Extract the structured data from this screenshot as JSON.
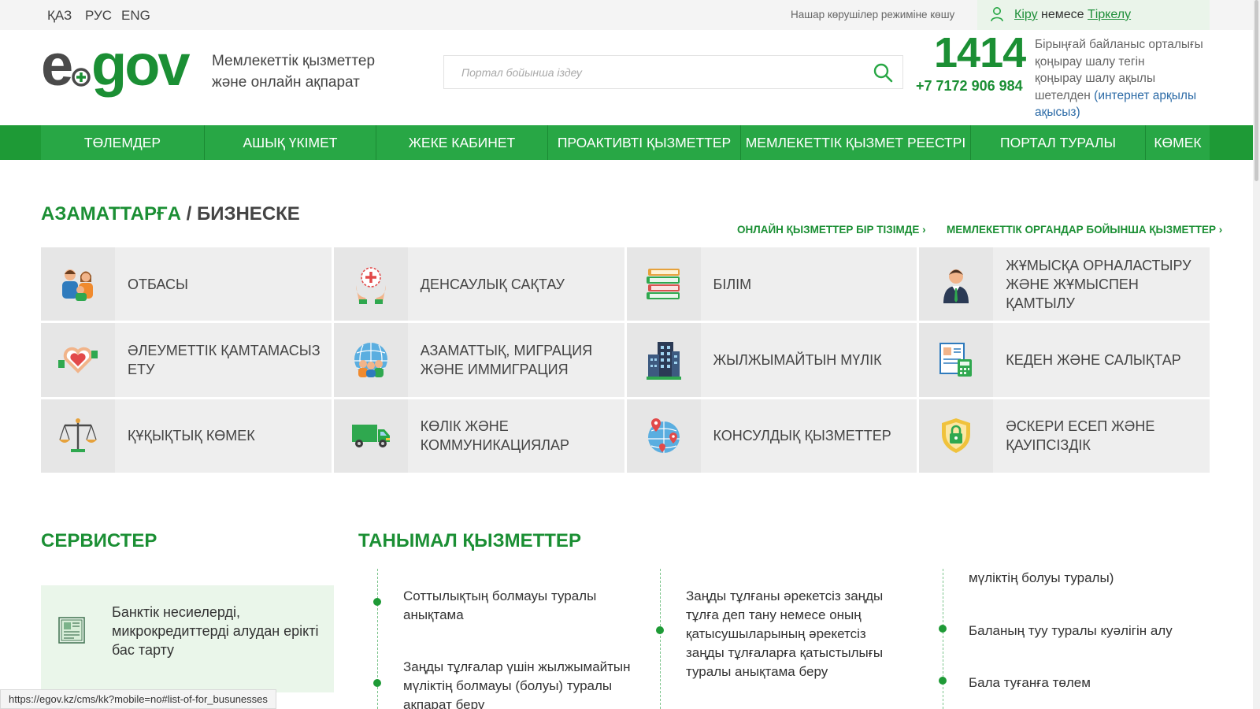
{
  "topbar": {
    "languages": [
      "ҚАЗ",
      "РУС",
      "ENG"
    ],
    "visually_impaired": "Нашар көрушілер режиміне көшу",
    "login_text": "Кіру",
    "login_sep": " немесе ",
    "register_text": "Тіркелу"
  },
  "header": {
    "logo_text": "egov",
    "tagline_1": "Мемлекеттік қызметтер",
    "tagline_2": "және онлайн ақпарат",
    "search_placeholder": "Портал бойынша іздеу",
    "hotline_number": "1414",
    "phone": "+7 7172 906 984",
    "contact_1": "Бірыңғай байланыс орталығы",
    "contact_2": "қоңырау шалу тегін",
    "contact_3": "қоңырау шалу ақылы",
    "contact_4": "шетелден ",
    "contact_5": "(интернет арқылы ақысыз)"
  },
  "nav": [
    "ТӨЛЕМДЕР",
    "АШЫҚ ҮКІМЕТ",
    "ЖЕКЕ КАБИНЕТ",
    "ПРОАКТИВТІ ҚЫЗМЕТТЕР",
    "МЕМЛЕКЕТТІК ҚЫЗМЕТ РЕЕСТРІ",
    "ПОРТАЛ ТУРАЛЫ",
    "КӨМЕК"
  ],
  "citizens": {
    "title": "АЗАМАТТАРҒА",
    "title_sep": " / ",
    "title_2": "БИЗНЕСКЕ",
    "link_1": "ОНЛАЙН ҚЫЗМЕТТЕР БІР ТІЗІМДЕ ›",
    "link_2": "МЕМЛЕКЕТТІК ОРГАНДАР БОЙЫНША ҚЫЗМЕТТЕР ›",
    "tiles": [
      {
        "label": "Отбасы",
        "icon": "family-icon"
      },
      {
        "label": "Денсаулық сақтау",
        "icon": "health-icon"
      },
      {
        "label": "Білім",
        "icon": "books-icon"
      },
      {
        "label": "Жұмысқа орналастыру және жұмыспен қамтылу",
        "icon": "employee-icon"
      },
      {
        "label": "Әлеуметтік қамтамасыз ету",
        "icon": "heart-hands-icon"
      },
      {
        "label": "Азаматтық, миграция және иммиграция",
        "icon": "globe-people-icon"
      },
      {
        "label": "Жылжымайтын мүлік",
        "icon": "building-icon"
      },
      {
        "label": "Кеден және салықтар",
        "icon": "tax-calculator-icon"
      },
      {
        "label": "Құқықтық көмек",
        "icon": "scales-icon"
      },
      {
        "label": "Көлік және коммуникациялар",
        "icon": "truck-icon"
      },
      {
        "label": "Консулдық қызметтер",
        "icon": "globe-pin-icon"
      },
      {
        "label": "Әскери есеп және қауіпсіздік",
        "icon": "shield-lock-icon"
      }
    ]
  },
  "services": {
    "title": "СЕРВИСТЕР",
    "card_label": "Банктік несиелерді, микрокредиттерді алудан ерікті бас тарту"
  },
  "popular": {
    "title": "ТАНЫМАЛ ҚЫЗМЕТТЕР",
    "col1_item1": "Соттылықтың болмауы туралы анықтама",
    "col1_item2": "Заңды тұлғалар үшін жылжымайтын мүліктің болмауы (болуы) туралы ақпарат беру",
    "col2_item1": "Заңды тұлғаны әрекетсіз заңды тұлға деп тану немесе оның қатысушыларының әрекетсіз заңды тұлғаларға қатыстылығы туралы анықтама беру",
    "col3_item0": "мүліктің болуы туралы)",
    "col3_item1": "Баланың туу туралы куәлігін алу",
    "col3_item2": "Бала туғанға төлем"
  },
  "status_url": "https://egov.kz/cms/kk?mobile=no#list-of-for_busunesses",
  "colors": {
    "brand_green": "#1b8f34",
    "nav_green": "#28a745",
    "link_blue": "#2b6aa6"
  }
}
